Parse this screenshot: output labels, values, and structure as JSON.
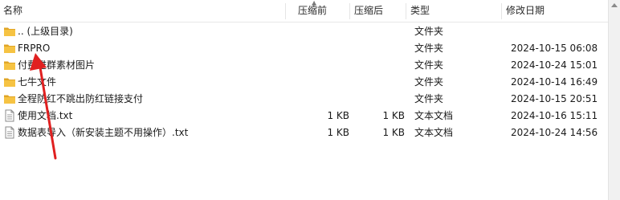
{
  "columns": {
    "name": "名称",
    "compressed_size": "压缩前",
    "original_size": "压缩后",
    "type": "类型",
    "modified": "修改日期"
  },
  "rows": [
    {
      "name": ".. (上级目录)",
      "icon": "folder-icon",
      "compressed_size": "",
      "original_size": "",
      "type": "文件夹",
      "modified": ""
    },
    {
      "name": "FRPRO",
      "icon": "folder-icon",
      "compressed_size": "",
      "original_size": "",
      "type": "文件夹",
      "modified": "2024-10-15 06:08"
    },
    {
      "name": "付费进群素材图片",
      "icon": "folder-icon",
      "compressed_size": "",
      "original_size": "",
      "type": "文件夹",
      "modified": "2024-10-24 15:01"
    },
    {
      "name": "七牛文件",
      "icon": "folder-icon",
      "compressed_size": "",
      "original_size": "",
      "type": "文件夹",
      "modified": "2024-10-14 16:49"
    },
    {
      "name": "全程防红不跳出防红链接支付",
      "icon": "folder-icon",
      "compressed_size": "",
      "original_size": "",
      "type": "文件夹",
      "modified": "2024-10-15 20:51"
    },
    {
      "name": "使用文档.txt",
      "icon": "text-file-icon",
      "compressed_size": "1 KB",
      "original_size": "1 KB",
      "type": "文本文档",
      "modified": "2024-10-16 15:11"
    },
    {
      "name": "数据表导入（新安装主题不用操作）.txt",
      "icon": "text-file-icon",
      "compressed_size": "1 KB",
      "original_size": "1 KB",
      "type": "文本文档",
      "modified": "2024-10-24 14:56"
    }
  ],
  "colors": {
    "folder": "#f6c343",
    "folder_dark": "#e0a526",
    "arrow": "#e02020"
  }
}
